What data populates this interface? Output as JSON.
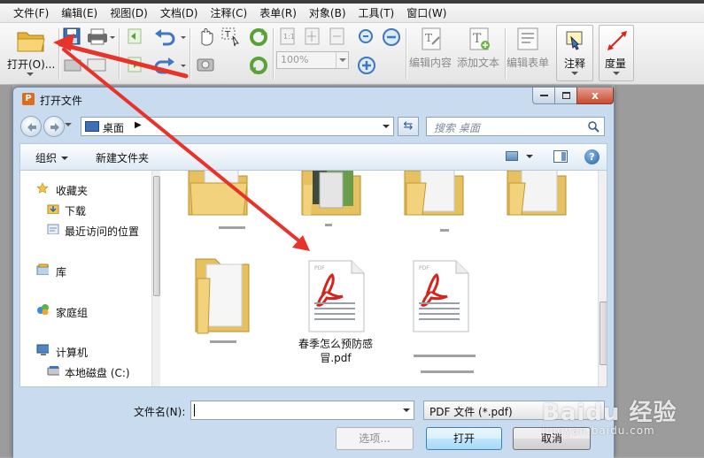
{
  "menu": [
    "文件(F)",
    "编辑(E)",
    "视图(D)",
    "文档(D)",
    "注释(C)",
    "表单(R)",
    "对象(B)",
    "工具(T)",
    "窗口(W)"
  ],
  "toolbar": {
    "open_label": "打开(O)...",
    "zoom_value": "100%",
    "edit_content": "编辑内容",
    "add_text": "添加文本",
    "edit_form": "编辑表单",
    "annotate": "注释",
    "measure": "度量"
  },
  "dialog": {
    "title": "打开文件",
    "close_glyph": "x",
    "address": "桌面",
    "search_placeholder": "搜索 桌面",
    "organize": "组织",
    "new_folder": "新建文件夹",
    "help_glyph": "?",
    "nav": {
      "favorites": "收藏夹",
      "downloads": "下载",
      "recent": "最近访问的位置",
      "libraries": "库",
      "homegroup": "家庭组",
      "computer": "计算机",
      "local_disk": "本地磁盘 (C:)"
    },
    "files": {
      "pdf_name": "春季怎么预防感冒.pdf"
    },
    "filename_label": "文件名(N):",
    "filename_value": "",
    "filetype": "PDF 文件 (*.pdf)",
    "tools_button": "选项...",
    "open_button": "打开",
    "cancel_button": "取消"
  },
  "watermark": {
    "main": "Baidu 经验",
    "sub": "jingyan.baidu.com"
  },
  "colors": {
    "annotation_arrow": "#e8332b",
    "dialog_frame": "#c9dcef",
    "pdf_red": "#d7231d"
  }
}
